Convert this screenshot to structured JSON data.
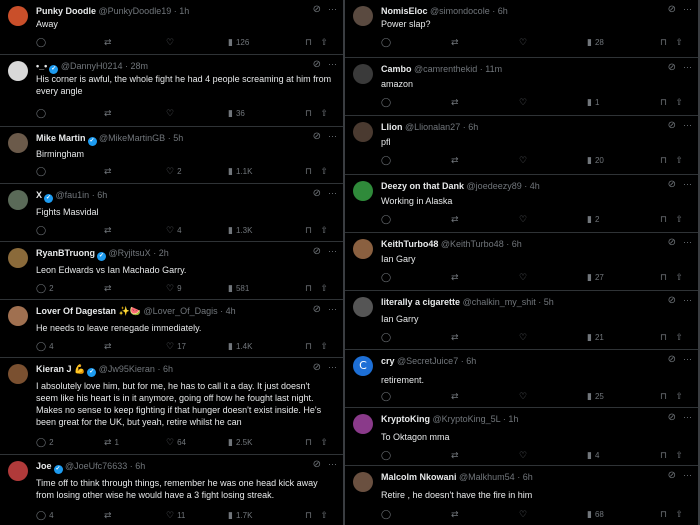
{
  "colors": {
    "background": "#000000",
    "text": "#e7e9ea",
    "muted": "#71767b",
    "verified": "#1d9bf0",
    "divider": "#2f3336"
  },
  "left_tweets": [
    {
      "name": "Punky Doodle",
      "verified": false,
      "handle": "@PunkyDoodle19",
      "time": "1h",
      "text": "Away",
      "reply": "",
      "retweet": "",
      "like": "",
      "views": "126",
      "avatar_color": "#c94f2a"
    },
    {
      "name": "•_•",
      "verified": true,
      "handle": "@DannyH0214",
      "time": "28m",
      "text": "His corner is awful, the whole fight he had 4 people screaming at him from every angle",
      "reply": "",
      "retweet": "",
      "like": "",
      "views": "36",
      "avatar_color": "#d8d8d8"
    },
    {
      "name": "Mike Martin",
      "verified": true,
      "handle": "@MikeMartinGB",
      "time": "5h",
      "text": "Birmingham",
      "reply": "",
      "retweet": "",
      "like": "2",
      "views": "1.1K",
      "avatar_color": "#6b5a4a"
    },
    {
      "name": "X",
      "verified": true,
      "handle": "@fau1in",
      "time": "6h",
      "text": "Fights Masvidal",
      "reply": "",
      "retweet": "",
      "like": "4",
      "views": "1.3K",
      "avatar_color": "#5a6a58"
    },
    {
      "name": "RyanBTruong",
      "verified": true,
      "handle": "@RyjitsuX",
      "time": "2h",
      "text": "Leon Edwards vs Ian Machado Garry.",
      "reply": "2",
      "retweet": "",
      "like": "9",
      "views": "581",
      "avatar_color": "#8a6a3a"
    },
    {
      "name": "Lover Of Dagestan ✨🍉",
      "verified": false,
      "handle": "@Lover_Of_Dagis",
      "time": "4h",
      "text": "He needs to leave renegade immediately.",
      "reply": "4",
      "retweet": "",
      "like": "17",
      "views": "1.4K",
      "avatar_color": "#a07050"
    },
    {
      "name": "Kieran J 💪",
      "verified": true,
      "handle": "@Jw95Kieran",
      "time": "6h",
      "text": "I absolutely love him, but for me, he has to call it a day. It just doesn't seem like his heart is in it anymore, going off how he fought last night. Makes no sense to keep fighting if that hunger doesn't exist inside. He's been great for the UK, but yeah, retire whilst he can",
      "reply": "2",
      "retweet": "1",
      "like": "64",
      "views": "2.5K",
      "avatar_color": "#7a5030"
    },
    {
      "name": "Joe",
      "verified": true,
      "handle": "@JoeUfc76633",
      "time": "6h",
      "text": "Time off to think through things, remember he was one head kick away from losing other wise he would have a 3 fight losing streak.",
      "reply": "4",
      "retweet": "",
      "like": "11",
      "views": "1.7K",
      "avatar_color": "#b03a3a"
    }
  ],
  "right_tweets": [
    {
      "name": "NomisEloc",
      "verified": false,
      "handle": "@simondocole",
      "time": "6h",
      "text": "Power slap?",
      "reply": "",
      "retweet": "",
      "like": "",
      "views": "28",
      "avatar_color": "#5a4a40"
    },
    {
      "name": "Cambo",
      "verified": false,
      "handle": "@camrenthekid",
      "time": "11m",
      "text": "amazon",
      "reply": "",
      "retweet": "",
      "like": "",
      "views": "1",
      "avatar_color": "#3a3a3a"
    },
    {
      "name": "Llion",
      "verified": false,
      "handle": "@Llionalan27",
      "time": "6h",
      "text": "pfl",
      "reply": "",
      "retweet": "",
      "like": "",
      "views": "20",
      "avatar_color": "#4a3a30"
    },
    {
      "name": "Deezy on that Dank",
      "verified": false,
      "handle": "@joedeezy89",
      "time": "4h",
      "text": "Working in Alaska",
      "reply": "",
      "retweet": "",
      "like": "",
      "views": "2",
      "avatar_color": "#2f8a3a"
    },
    {
      "name": "KeithTurbo48",
      "verified": false,
      "handle": "@KeithTurbo48",
      "time": "6h",
      "text": "Ian Gary",
      "reply": "",
      "retweet": "",
      "like": "",
      "views": "27",
      "avatar_color": "#8a6040"
    },
    {
      "name": "literally a cigarette",
      "verified": false,
      "handle": "@chalkin_my_shit",
      "time": "5h",
      "text": "Ian Garry",
      "reply": "",
      "retweet": "",
      "like": "",
      "views": "21",
      "avatar_color": "#555555"
    },
    {
      "name": "cry",
      "verified": false,
      "handle": "@SecretJuice7",
      "time": "6h",
      "text": "retirement.",
      "reply": "",
      "retweet": "",
      "like": "",
      "views": "25",
      "avatar_color": "#1d6fd6",
      "avatar_letter": "C"
    },
    {
      "name": "KryptoKing",
      "verified": false,
      "handle": "@KryptoKing_5L",
      "time": "1h",
      "text": "To Oktagon mma",
      "reply": "",
      "retweet": "",
      "like": "",
      "views": "4",
      "avatar_color": "#8a3a8a"
    },
    {
      "name": "Malcolm Nkowani",
      "verified": false,
      "handle": "@Malkhum54",
      "time": "6h",
      "text": "Retire , he doesn't have the fire in him",
      "reply": "",
      "retweet": "",
      "like": "",
      "views": "68",
      "avatar_color": "#6a5040"
    }
  ]
}
